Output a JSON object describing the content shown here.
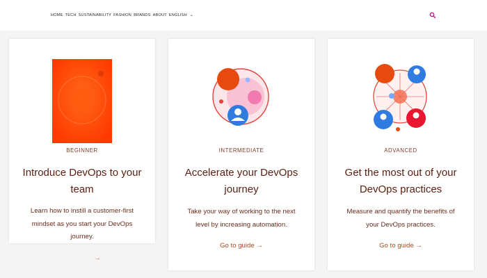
{
  "nav": {
    "links": [
      "HOME",
      "TECH",
      "SUSTAINABILITY",
      "FASHION",
      "BRANDS",
      "ABOUT",
      "ENGLISH"
    ],
    "search_icon": "search-icon",
    "chevron_icon": "chevron-down-icon"
  },
  "colors": {
    "accent": "#d9531e",
    "brand_dark": "#5a1f10",
    "search_icon": "#c2188a",
    "background": "#f4f4f4"
  },
  "cards": [
    {
      "level": "BEGINNER",
      "title": "Introduce DevOps to your team",
      "description": "Learn how to instill a customer-first mindset as you start your DevOps journey.",
      "guide": ""
    },
    {
      "level": "INTERMEDIATE",
      "title": "Accelerate your DevOps journey",
      "description": "Take your way of working to the next level by increasing automation.",
      "guide": "Go to guide →"
    },
    {
      "level": "ADVANCED",
      "title": "Get the most out of your DevOps practices",
      "description": "Measure and quantify the benefits of your DevOps practices.",
      "guide": "Go to guide →"
    }
  ],
  "below_card_link": "→"
}
